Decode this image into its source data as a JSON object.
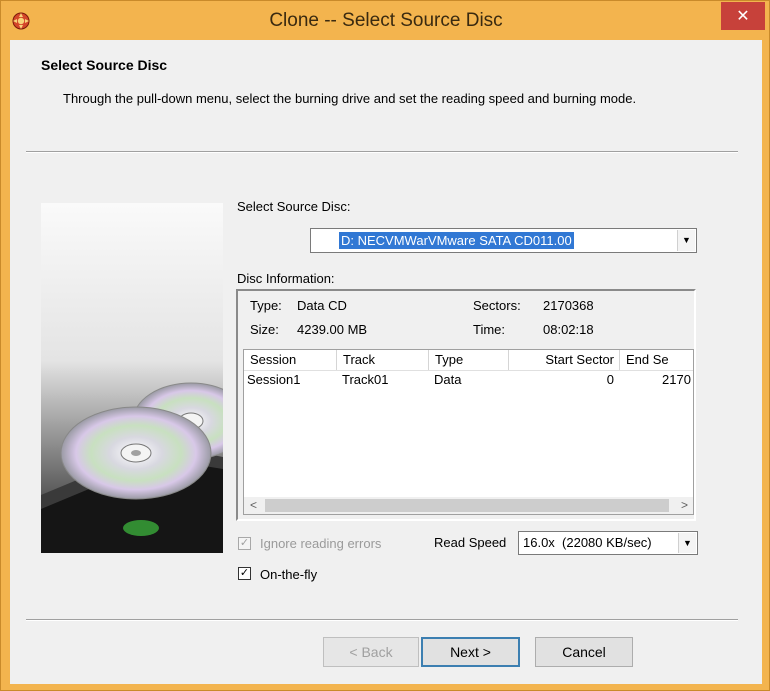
{
  "window": {
    "title": "Clone  --  Select Source Disc",
    "close_glyph": "✕"
  },
  "header": {
    "title": "Select Source Disc",
    "description": "Through the pull-down menu, select the burning drive and set the reading speed and burning mode."
  },
  "source": {
    "label": "Select Source Disc:",
    "selected": "D: NECVMWarVMware SATA CD011.00"
  },
  "disc_info": {
    "label": "Disc Information:",
    "type_label": "Type:",
    "type_value": "Data CD",
    "sectors_label": "Sectors:",
    "sectors_value": "2170368",
    "size_label": "Size:",
    "size_value": "4239.00 MB",
    "time_label": "Time:",
    "time_value": "08:02:18",
    "columns": [
      "Session",
      "Track",
      "Type",
      "Start Sector",
      "End Se"
    ],
    "rows": [
      {
        "session": "Session1",
        "track": "Track01",
        "type": "Data",
        "start": "0",
        "end": "2170"
      }
    ]
  },
  "options": {
    "ignore_errors_label": "Ignore reading errors",
    "ignore_errors_checked": true,
    "on_the_fly_label": "On-the-fly",
    "on_the_fly_checked": true,
    "read_speed_label": "Read Speed",
    "read_speed_value": "16.0x  (22080 KB/sec)"
  },
  "buttons": {
    "back": "< Back",
    "next": "Next >",
    "cancel": "Cancel"
  },
  "colors": {
    "frame": "#f3b44e",
    "selection": "#3178d4",
    "close": "#c7413a"
  }
}
